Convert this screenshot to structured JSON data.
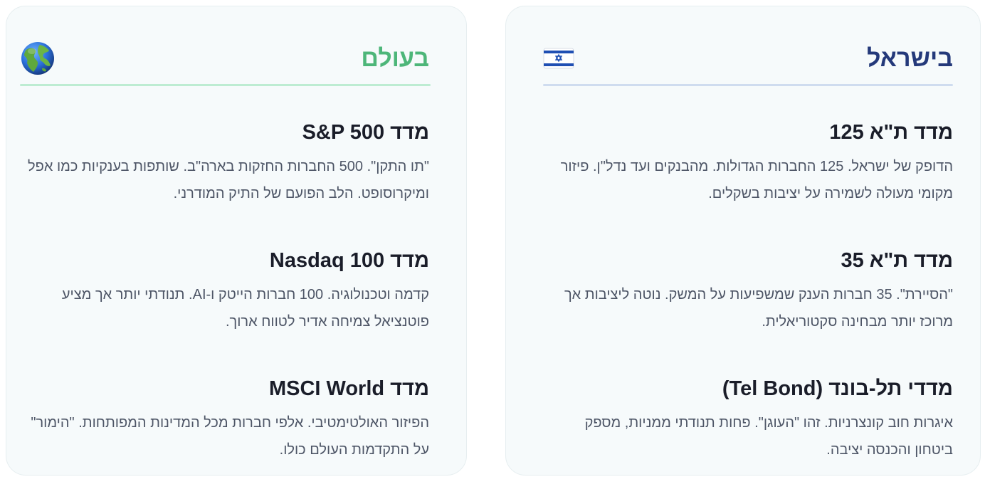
{
  "world": {
    "title": "בעולם",
    "icon": "globe-icon",
    "accent": "#4db679",
    "items": [
      {
        "title": "מדד S&P 500",
        "desc": "\"תו התקן\". 500 החברות החזקות בארה\"ב. שותפות בענקיות כמו אפל ומיקרוסופט. הלב הפועם של התיק המודרני."
      },
      {
        "title": "מדד Nasdaq 100",
        "desc": "קדמה וטכנולוגיה. 100 חברות הייטק ו-AI. תנודתי יותר אך מציע פוטנציאל צמיחה אדיר לטווח ארוך."
      },
      {
        "title": "מדד MSCI World",
        "desc": "הפיזור האולטימטיבי. אלפי חברות מכל המדינות המפותחות. \"הימור\" על התקדמות העולם כולו."
      }
    ]
  },
  "israel": {
    "title": "בישראל",
    "icon": "israel-flag-icon",
    "accent": "#24397a",
    "items": [
      {
        "title": "מדד ת\"א 125",
        "desc": "הדופק של ישראל. 125 החברות הגדולות. מהבנקים ועד נדל\"ן. פיזור מקומי מעולה לשמירה על יציבות בשקלים."
      },
      {
        "title": "מדד ת\"א 35",
        "desc": "\"הסיירת\". 35 חברות הענק שמשפיעות על המשק. נוטה ליציבות אך מרוכז יותר מבחינה סקטוריאלית."
      },
      {
        "title": "מדדי תל-בונד (Tel Bond)",
        "desc": "איגרות חוב קונצרניות. זהו \"העוגן\". פחות תנודתי ממניות, מספק ביטחון והכנסה יציבה."
      }
    ]
  }
}
